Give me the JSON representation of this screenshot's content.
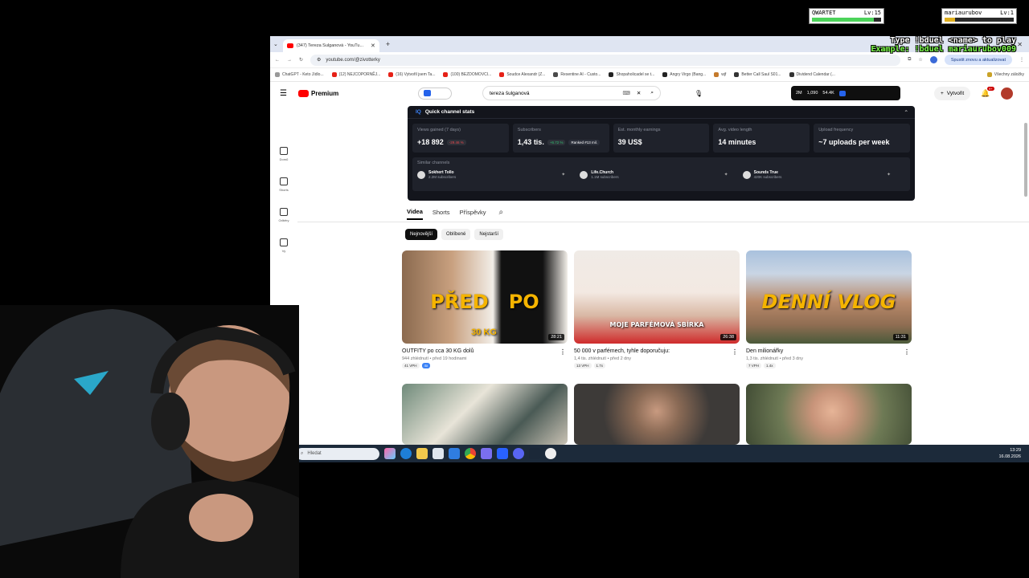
{
  "overlay": {
    "player1": {
      "name": "QWARTET",
      "level": "Lv:15",
      "hp_label": "HP",
      "hp_fraction": 0.9
    },
    "player2": {
      "name": "mariaurubov",
      "level": "Lv:1",
      "hp_label": "HP",
      "hp_fraction": 0.15
    },
    "duel_line1": "Type !bduel <name> to play",
    "duel_line2": "Example: !bduel mariaurubov009"
  },
  "browser": {
    "tab_title": "(347) Tereza Šulganová - YouTu...",
    "url": "youtube.com/@zivotterky",
    "update_button": "Spustit znovu a aktualizovat",
    "bookmarks": [
      "ChatGPT - Keto Jídlo...",
      "(12) NEJCOPORNĚJ...",
      "(16) Vytvořil jsem Ta...",
      "(100) BEZDOMOVCI...",
      "Soudce Alexandr (Z...",
      "Resentine AI - Custo...",
      "Shopaholicadel se t...",
      "Angry Virgo (Bang...",
      "wjf",
      "Better Call Saul S01...",
      "Dividend Calendar (...",
      "Všechny záložky"
    ],
    "bookmark_colors": [
      "#999999",
      "#e62117",
      "#e62117",
      "#e62117",
      "#e62117",
      "#4a4a4a",
      "#222222",
      "#222222",
      "#c47a2c",
      "#333333",
      "#333333",
      "#c9a227"
    ]
  },
  "youtube": {
    "logo_text": "Premium",
    "search_value": "tereza šulganová",
    "create_label": "Vytvořit",
    "notif_count": "9+",
    "header_stats": [
      "2M",
      "1,090",
      "54.4K"
    ],
    "guide": [
      {
        "label": "Domů",
        "icon": "home-icon"
      },
      {
        "label": "Shorts",
        "icon": "shorts-icon"
      },
      {
        "label": "Odběry",
        "icon": "subscriptions-icon"
      },
      {
        "label": "Vy",
        "icon": "you-icon"
      }
    ]
  },
  "stats_panel": {
    "title": "Quick channel stats",
    "cards": [
      {
        "label": "Views gained (7 days)",
        "value": "+18 892",
        "badge": "-29.46 %",
        "badge_color": "#e5484d"
      },
      {
        "label": "Subscribers",
        "value": "1,43 tis.",
        "badge": "+6.72 %",
        "badge_color": "#2fbf71",
        "extra": "Ranked #13 mil."
      },
      {
        "label": "Est. monthly earnings",
        "value": "39 US$"
      },
      {
        "label": "Avg. video length",
        "value": "14 minutes"
      },
      {
        "label": "Upload frequency",
        "value": "~7 uploads per week"
      }
    ],
    "similar_title": "Similar channels",
    "similar": [
      {
        "name": "Sokhert Tollo",
        "subs": "2.2M subscribers"
      },
      {
        "name": "Life.Church",
        "subs": "1.1M subscribers"
      },
      {
        "name": "Sounds True",
        "subs": "420K subscribers"
      }
    ]
  },
  "channel_tabs": [
    "Videa",
    "Shorts",
    "Příspěvky"
  ],
  "chips": [
    "Nejnovější",
    "Oblíbené",
    "Nejstarší"
  ],
  "videos": [
    {
      "title": "OUTFITY po cca 30 KG dolů",
      "meta": "944 zhlédnutí • před 19 hodinami",
      "duration": "28:21",
      "tag1": "41 VPH",
      "tag2": "4x",
      "thumb_text": "PŘED   PO",
      "thumb_sub": "30 KG"
    },
    {
      "title": "50 000 v parfémech, tyhle doporučuju:",
      "meta": "1,4 tis. zhlédnutí • před 2 dny",
      "duration": "26:38",
      "tag1": "13 VPH",
      "tag2": "1.7x",
      "thumb_text": "MOJE PARFÉMOVÁ SBÍRKA"
    },
    {
      "title": "Den milionářky",
      "meta": "1,3 tis. zhlédnutí • před 3 dny",
      "duration": "11:31",
      "tag1": "7 VPH",
      "tag2": "1.4x",
      "thumb_text": "DENNÍ VLOG"
    }
  ],
  "taskbar": {
    "search_placeholder": "Hledat",
    "time": "13:29",
    "date": "16.08.2026"
  }
}
